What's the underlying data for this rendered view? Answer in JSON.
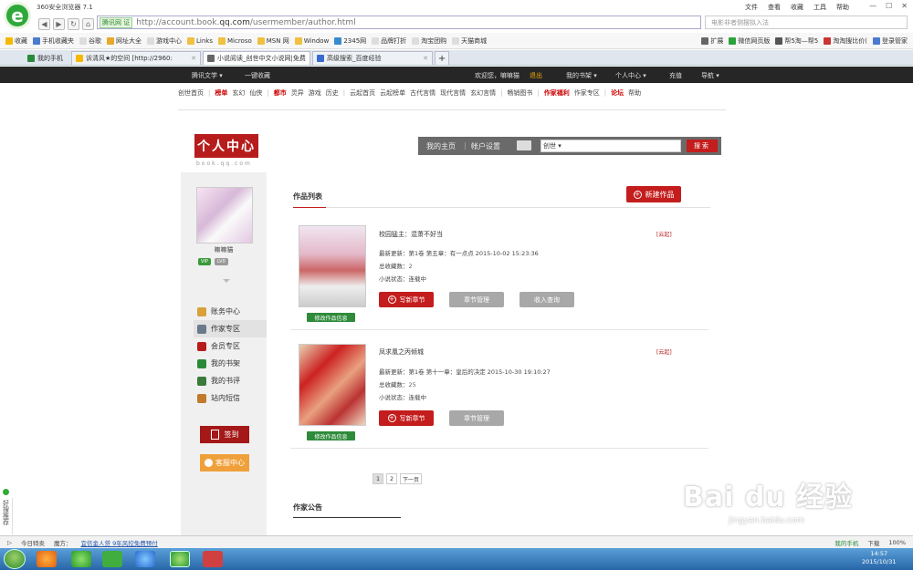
{
  "browser": {
    "title": "360安全浏览器 7.1",
    "menu": [
      "文件",
      "查看",
      "收藏",
      "工具",
      "帮助"
    ],
    "url_badge": "腾讯网 ",
    "url_badge_tag": "证",
    "url_prefix": "http://account.book.",
    "url_domain": "qq.com",
    "url_path": "/usermember/author.html",
    "search_placeholder": "电影非者侧摆拟入法",
    "bookmarks": [
      "收藏",
      "手机收藏夹",
      "谷歌",
      "网址大全",
      "游戏中心",
      "Links",
      "Microso",
      "MSN 网",
      "Window",
      "2345网",
      "品牌打折",
      "淘宝团购",
      "天猫商城"
    ],
    "bookmarks_right": [
      "扩展",
      "微信网页版",
      "帮5淘—帮5",
      "淘淘搜比价(",
      "登录管家"
    ],
    "tabs": [
      {
        "label": "我的手机"
      },
      {
        "label": "诉清风★的空间 [http://2960:"
      },
      {
        "label": "小说阅读_创世中文小说网|免费"
      },
      {
        "label": "高级搜索_百度经验"
      }
    ]
  },
  "site": {
    "topbar": {
      "left": [
        "腾讯文学 ▾",
        "一键收藏"
      ],
      "welcome": "欢迎您，嘛嘛猫",
      "logout": "退出",
      "right": [
        "我的书架 ▾",
        "个人中心 ▾",
        "充值",
        "导航 ▾"
      ]
    },
    "subnav": [
      {
        "t": "创世首页",
        "red": false
      },
      {
        "t": "|",
        "sep": true
      },
      {
        "t": "榜单",
        "red": true
      },
      {
        "t": "玄幻",
        "red": false
      },
      {
        "t": "仙侠",
        "red": false
      },
      {
        "t": "|",
        "sep": true
      },
      {
        "t": "都市",
        "red": true
      },
      {
        "t": "灵异",
        "red": false
      },
      {
        "t": "游戏",
        "red": false
      },
      {
        "t": "历史",
        "red": false
      },
      {
        "t": "|",
        "sep": true
      },
      {
        "t": "云起首页",
        "red": false
      },
      {
        "t": "云起榜单",
        "red": false
      },
      {
        "t": "古代言情",
        "red": false
      },
      {
        "t": "现代言情",
        "red": false
      },
      {
        "t": "玄幻言情",
        "red": false
      },
      {
        "t": "|",
        "sep": true
      },
      {
        "t": "畅销图书",
        "red": false
      },
      {
        "t": "|",
        "sep": true
      },
      {
        "t": "作家福利",
        "red": true
      },
      {
        "t": "作家专区",
        "red": false
      },
      {
        "t": "|",
        "sep": true
      },
      {
        "t": "论坛",
        "red": true
      },
      {
        "t": "帮助",
        "red": false
      }
    ],
    "brand_title": "个人中心",
    "brand_url": "book.qq.com",
    "graybar": {
      "home": "我的主页",
      "account": "帐户设置",
      "search_scope": "创世 ▾",
      "search_btn": "搜索"
    }
  },
  "sidebar": {
    "username": "嘛嘛猫",
    "badges": [
      "VIP",
      "LV0"
    ],
    "items": [
      {
        "label": "账务中心",
        "color": "#d9a13a",
        "active": false
      },
      {
        "label": "作家专区",
        "color": "#6a7a8a",
        "active": true
      },
      {
        "label": "会员专区",
        "color": "#b71c1c",
        "active": false
      },
      {
        "label": "我的书架",
        "color": "#2a8a3a",
        "active": false
      },
      {
        "label": "我的书评",
        "color": "#3a7a3a",
        "active": false
      },
      {
        "label": "站内短信",
        "color": "#c07a2a",
        "active": false
      }
    ],
    "sign_label": "签到",
    "service_label": "客服中心"
  },
  "main": {
    "list_title": "作品列表",
    "new_work": "新建作品",
    "works": [
      {
        "title": "校园猛主：混萧不好当",
        "tag": "[云起]",
        "update_label": "最新更新：",
        "update_value": "第1卷 第五章：有一点点 2015-10-02 15:23:36",
        "fav_label": "总收藏数：",
        "fav_value": "2",
        "status_label": "小说状态：",
        "status_value": "连载中",
        "edit_label": "修改作品信息",
        "buttons": [
          "写新章节",
          "章节管理",
          "收入查询"
        ]
      },
      {
        "title": "凤求凰之丙倾城",
        "tag": "[云起]",
        "update_label": "最新更新：",
        "update_value": "第1卷 第十一章：皇后的决定 2015-10-30 19:10:27",
        "fav_label": "总收藏数：",
        "fav_value": "25",
        "status_label": "小说状态：",
        "status_value": "连载中",
        "edit_label": "修改作品信息",
        "buttons": [
          "写新章节",
          "章节管理"
        ]
      }
    ],
    "pager": [
      "1",
      "2",
      "下一页"
    ],
    "notice_title": "作家公告"
  },
  "statusbar": {
    "left": [
      "今日特卖",
      "魔方：",
      "宜信金人贷  9年风控免费预付"
    ],
    "right": [
      "我的手机",
      "下载",
      "100%"
    ]
  },
  "taskbar": {
    "time": "14:57",
    "date": "2015/10/31"
  },
  "side_strip": "好搜推荐",
  "watermark": "Bai du 经验",
  "watermark_sub": "jingyan.baidu.com"
}
